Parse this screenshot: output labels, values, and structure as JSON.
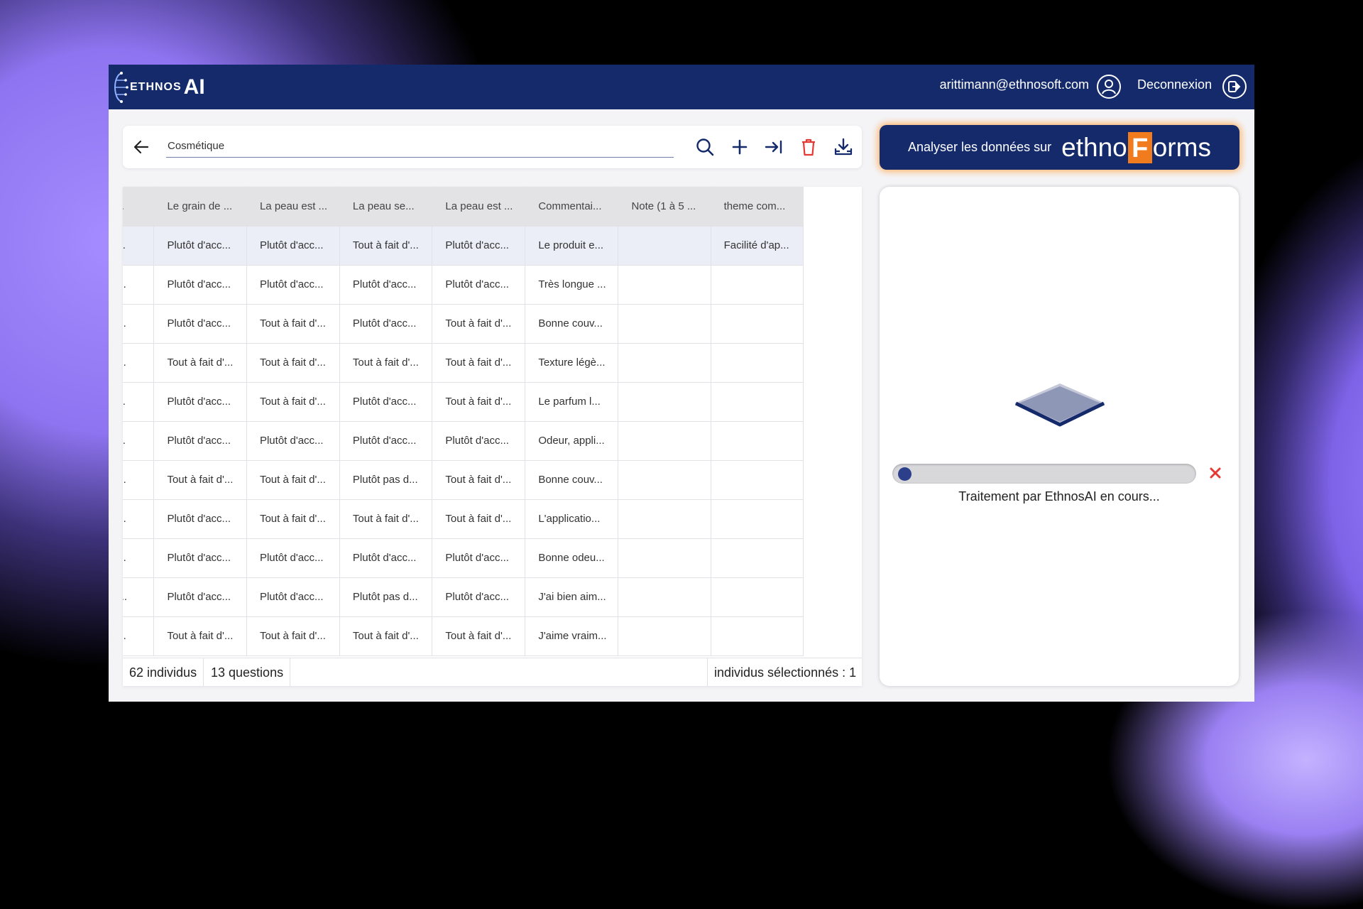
{
  "app": {
    "brand_small": "ETHNOS",
    "brand_big": "AI"
  },
  "header": {
    "user_email": "arittimann@ethnosoft.com",
    "logout_label": "Deconnexion"
  },
  "search": {
    "value": "Cosmétique"
  },
  "ai_button": {
    "label": "Analyser les données sur",
    "brand_pre": "ethno",
    "brand_f": "F",
    "brand_post": "orms"
  },
  "table": {
    "columns": [
      "peau se...",
      "Le grain de ...",
      "La peau est ...",
      "La peau se...",
      "La peau est ...",
      "Commentai...",
      "Note (1 à 5 ...",
      "theme com..."
    ],
    "rows": [
      [
        "tôt d'acc...",
        "Plutôt d'acc...",
        "Plutôt d'acc...",
        "Tout à fait d'...",
        "Plutôt d'acc...",
        "Le produit e...",
        "",
        "Facilité d'ap..."
      ],
      [
        "t à fait d'...",
        "Plutôt d'acc...",
        "Plutôt d'acc...",
        "Plutôt d'acc...",
        "Plutôt d'acc...",
        "Très longue ...",
        "",
        ""
      ],
      [
        "t à fait d'...",
        "Plutôt d'acc...",
        "Tout à fait d'...",
        "Plutôt d'acc...",
        "Tout à fait d'...",
        "Bonne couv...",
        "",
        ""
      ],
      [
        "t à fait d'...",
        "Tout à fait d'...",
        "Tout à fait d'...",
        "Tout à fait d'...",
        "Tout à fait d'...",
        "Texture légè...",
        "",
        ""
      ],
      [
        "tôt d'acc...",
        "Plutôt d'acc...",
        "Tout à fait d'...",
        "Plutôt d'acc...",
        "Tout à fait d'...",
        "Le parfum l...",
        "",
        ""
      ],
      [
        "tôt d'acc...",
        "Plutôt d'acc...",
        "Plutôt d'acc...",
        "Plutôt d'acc...",
        "Plutôt d'acc...",
        "Odeur, appli...",
        "",
        ""
      ],
      [
        "t à fait d'...",
        "Tout à fait d'...",
        "Tout à fait d'...",
        "Plutôt pas d...",
        "Tout à fait d'...",
        "Bonne couv...",
        "",
        ""
      ],
      [
        "t à fait d'...",
        "Plutôt d'acc...",
        "Tout à fait d'...",
        "Tout à fait d'...",
        "Tout à fait d'...",
        "L'applicatio...",
        "",
        ""
      ],
      [
        "t à fait d'...",
        "Plutôt d'acc...",
        "Plutôt d'acc...",
        "Plutôt d'acc...",
        "Plutôt d'acc...",
        "Bonne odeu...",
        "",
        ""
      ],
      [
        "tôt pas d...",
        "Plutôt d'acc...",
        "Plutôt d'acc...",
        "Plutôt pas d...",
        "Plutôt d'acc...",
        "J'ai bien aim...",
        "",
        ""
      ],
      [
        "t à fait d'...",
        "Tout à fait d'...",
        "Tout à fait d'...",
        "Tout à fait d'...",
        "Tout à fait d'...",
        "J'aime vraim...",
        "",
        ""
      ]
    ],
    "selected_row": 0
  },
  "footer": {
    "individus": "62 individus",
    "questions": "13 questions",
    "selected": "individus sélectionnés : 1"
  },
  "panel": {
    "progress_fraction": 0.05,
    "status": "Traitement par EthnosAI en cours..."
  },
  "colors": {
    "navy": "#142a6b",
    "accent_orange": "#f07c1d",
    "delete_red": "#e53935"
  }
}
